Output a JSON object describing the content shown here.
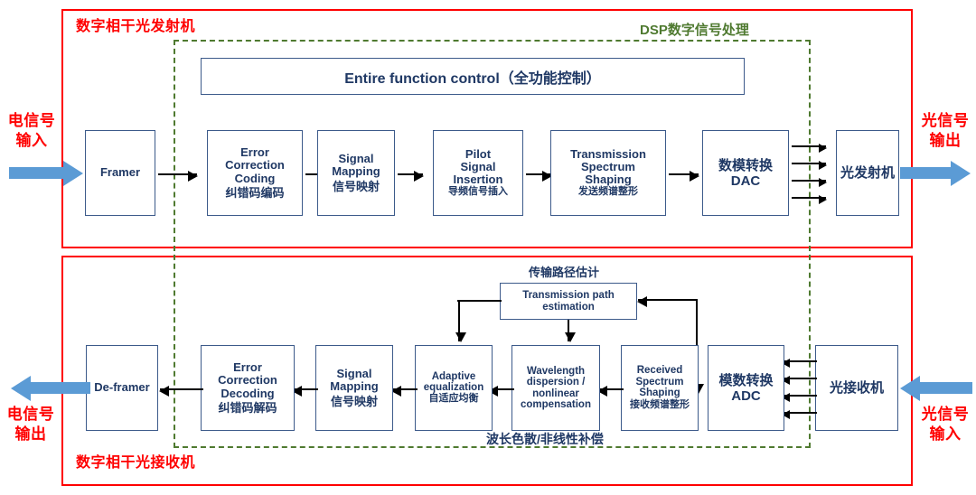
{
  "diagram": {
    "title_tx": "数字相干光发射机",
    "title_rx": "数字相干光接收机",
    "dsp_label": "DSP数字信号处理"
  },
  "io_labels": {
    "tx_in_line1": "电信号",
    "tx_in_line2": "输入",
    "tx_out_line1": "光信号",
    "tx_out_line2": "输出",
    "rx_out_line1": "电信号",
    "rx_out_line2": "输出",
    "rx_in_line1": "光信号",
    "rx_in_line2": "输入"
  },
  "control_bar": {
    "label": "Entire function control（全功能控制）"
  },
  "tx_blocks": [
    {
      "en1": "Framer",
      "en2": "",
      "en3": "",
      "cn": ""
    },
    {
      "en1": "Error",
      "en2": "Correction",
      "en3": "Coding",
      "cn": "纠错码编码"
    },
    {
      "en1": "Signal",
      "en2": "Mapping",
      "en3": "",
      "cn": "信号映射"
    },
    {
      "en1": "Pilot",
      "en2": "Signal",
      "en3": "Insertion",
      "cn": "导频信号插入"
    },
    {
      "en1": "Transmission",
      "en2": "Spectrum",
      "en3": "Shaping",
      "cn": "发送频谱整形"
    },
    {
      "en1": "",
      "en2": "",
      "en3": "",
      "cn_big1": "数模转换",
      "cn_big2": "DAC"
    },
    {
      "en1": "",
      "en2": "",
      "en3": "",
      "cn_big1": "光发射机",
      "cn_big2": ""
    }
  ],
  "rx_blocks": [
    {
      "en1": "De-framer",
      "en2": "",
      "en3": "",
      "en4": "",
      "cn": ""
    },
    {
      "en1": "Error",
      "en2": "Correction",
      "en3": "Decoding",
      "en4": "",
      "cn": "纠错码解码"
    },
    {
      "en1": "Signal",
      "en2": "Mapping",
      "en3": "",
      "en4": "",
      "cn": "信号映射"
    },
    {
      "en1": "Adaptive",
      "en2": "equalization",
      "en3": "",
      "en4": "",
      "cn": "自适应均衡"
    },
    {
      "en1": "Wavelength",
      "en2": "dispersion /",
      "en3": "nonlinear",
      "en4": "compensation",
      "cn": ""
    },
    {
      "en1": "Received",
      "en2": "Spectrum",
      "en3": "Shaping",
      "en4": "",
      "cn": "接收频谱整形"
    },
    {
      "en1": "",
      "en2": "",
      "en3": "",
      "en4": "",
      "cn_big1": "模数转换",
      "cn_big2": "ADC"
    },
    {
      "en1": "",
      "en2": "",
      "en3": "",
      "en4": "",
      "cn_big1": "光接收机",
      "cn_big2": ""
    }
  ],
  "estimation_block": {
    "caption_cn": "传输路径估计",
    "en1": "Transmission path",
    "en2": "estimation"
  },
  "rx_bottom_caption": "波长色散/非线性补偿",
  "colors": {
    "frame_red": "#ff0000",
    "dsp_green": "#4f7a30",
    "box_border": "#3c5a8a",
    "box_text": "#1f3864",
    "signal_blue": "#5b9bd5",
    "connector": "#000000"
  }
}
